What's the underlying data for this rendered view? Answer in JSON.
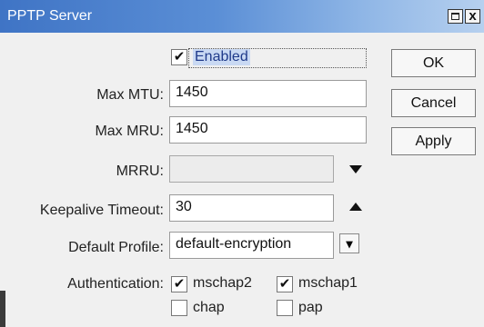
{
  "window": {
    "title": "PPTP Server"
  },
  "enabled": {
    "label": "Enabled",
    "checked": true
  },
  "fields": {
    "max_mtu": {
      "label": "Max MTU:",
      "value": "1450"
    },
    "max_mru": {
      "label": "Max MRU:",
      "value": "1450"
    },
    "mrru": {
      "label": "MRRU:",
      "value": ""
    },
    "keepalive": {
      "label": "Keepalive Timeout:",
      "value": "30"
    },
    "default_profile": {
      "label": "Default Profile:",
      "value": "default-encryption"
    }
  },
  "authentication": {
    "label": "Authentication:",
    "options": [
      {
        "label": "mschap2",
        "checked": true
      },
      {
        "label": "mschap1",
        "checked": true
      },
      {
        "label": "chap",
        "checked": false
      },
      {
        "label": "pap",
        "checked": false
      }
    ]
  },
  "buttons": {
    "ok": "OK",
    "cancel": "Cancel",
    "apply": "Apply"
  },
  "glyphs": {
    "check": "✔",
    "close": "x"
  }
}
